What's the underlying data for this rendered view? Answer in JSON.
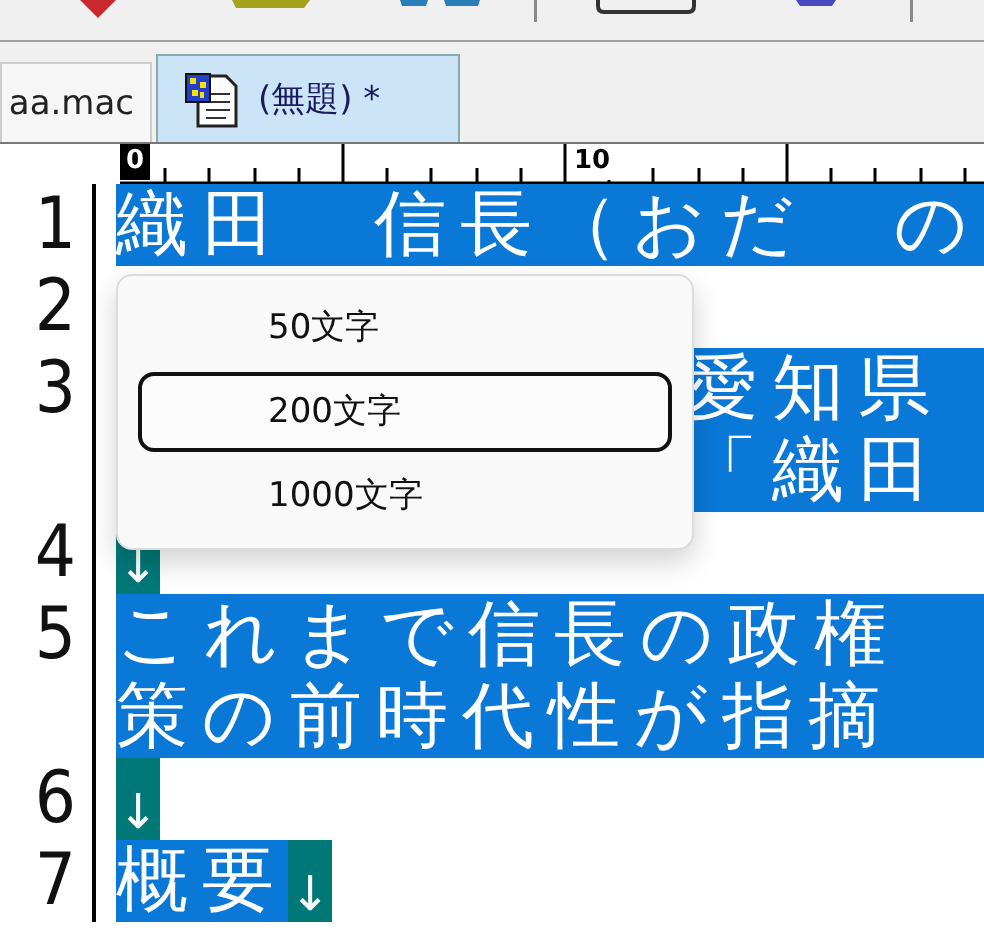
{
  "tabs": [
    {
      "label": "aa.mac",
      "selected": false
    },
    {
      "label": "(無題) *",
      "selected": true
    }
  ],
  "ruler": {
    "labels": [
      {
        "text": "0",
        "current": true
      },
      {
        "text": "10",
        "current": false
      }
    ]
  },
  "lines": [
    {
      "number": "1",
      "rows": [
        {
          "kind": "clipped",
          "text": "織田　信長（おだ　の",
          "selected": true
        }
      ]
    },
    {
      "number": "2"
    },
    {
      "number": "3",
      "rows": [
        {
          "kind": "covered",
          "text": "愛知県",
          "selected": true
        },
        {
          "kind": "covered",
          "text": "「織田",
          "selected": true
        }
      ]
    },
    {
      "number": "4",
      "rows": [
        {
          "kind": "end",
          "eol_mark": "↓",
          "selected": true
        }
      ]
    },
    {
      "number": "5",
      "rows": [
        {
          "kind": "clipped",
          "text": "これまで信長の政権",
          "selected": true
        },
        {
          "kind": "clipped",
          "text": "策の前時代性が指摘",
          "selected": true
        }
      ]
    },
    {
      "number": "6",
      "rows": [
        {
          "kind": "end",
          "eol_mark": "↓",
          "selected": true
        }
      ]
    },
    {
      "number": "7",
      "rows": [
        {
          "kind": "end",
          "text": "概要",
          "eol_mark": "↓",
          "selected": true
        }
      ]
    }
  ],
  "menu": {
    "items": [
      {
        "label": "50文字",
        "selected": false
      },
      {
        "label": "200文字",
        "selected": true
      },
      {
        "label": "1000文字",
        "selected": false
      }
    ]
  }
}
